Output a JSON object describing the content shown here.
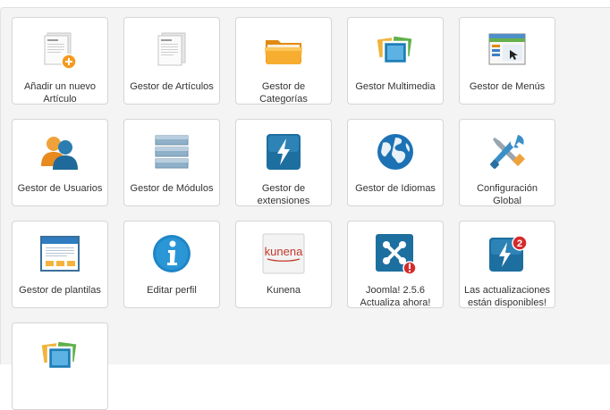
{
  "quickicons": [
    {
      "label": "Añadir un nuevo Artículo",
      "icon": "add-article-icon"
    },
    {
      "label": "Gestor de Artículos",
      "icon": "article-manager-icon"
    },
    {
      "label": "Gestor de Categorías",
      "icon": "folder-icon"
    },
    {
      "label": "Gestor Multimedia",
      "icon": "media-icon"
    },
    {
      "label": "Gestor de Menús",
      "icon": "menu-window-icon"
    },
    {
      "label": "Gestor de Usuarios",
      "icon": "users-icon"
    },
    {
      "label": "Gestor de Módulos",
      "icon": "modules-icon"
    },
    {
      "label": "Gestor de extensiones",
      "icon": "extensions-bolt-icon"
    },
    {
      "label": "Gestor de Idiomas",
      "icon": "globe-icon"
    },
    {
      "label": "Configuración Global",
      "icon": "tools-icon"
    },
    {
      "label": "Gestor de plantilas",
      "icon": "template-icon"
    },
    {
      "label": "Editar perfil",
      "icon": "info-icon"
    },
    {
      "label": "Kunena",
      "icon": "kunena-logo-icon",
      "logo_text": "kunena"
    },
    {
      "label": "Joomla! 2.5.6 Actualiza ahora!",
      "icon": "joomla-update-icon"
    },
    {
      "label": "Las actualizaciones están disponibles!",
      "icon": "extension-updates-icon",
      "badge": "2"
    },
    {
      "label": "",
      "icon": "media-icon"
    }
  ],
  "colors": {
    "panel_bg": "#f4f4f4",
    "tile_border": "#d5d5d5",
    "label_text": "#333333",
    "accent_blue": "#1f7fb6",
    "alert_red": "#d62b2b",
    "folder_orange": "#f6a623"
  }
}
